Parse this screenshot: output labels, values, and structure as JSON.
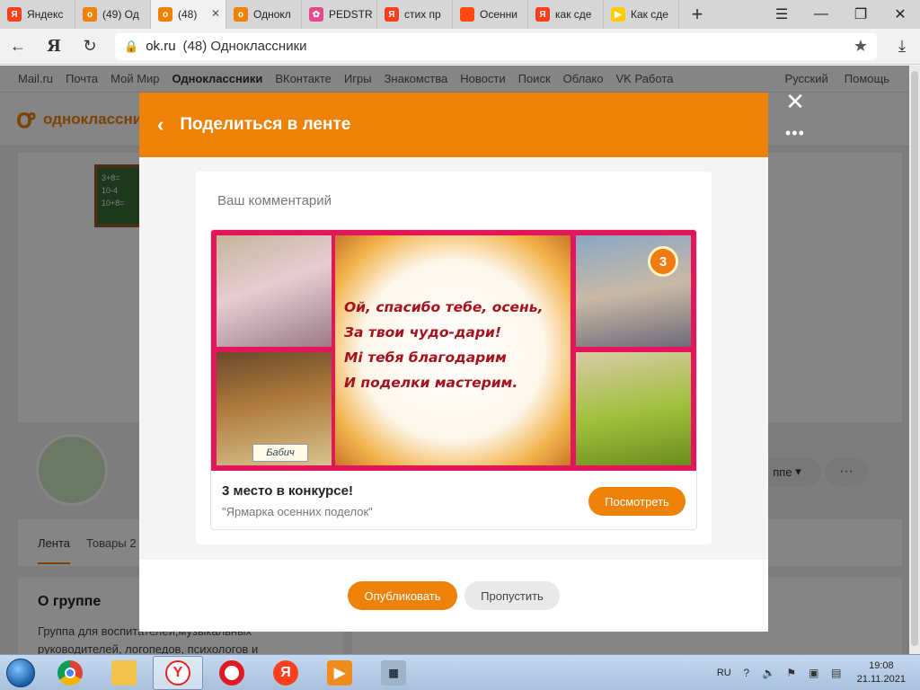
{
  "browser": {
    "tabs": [
      {
        "label": "Яндекс",
        "icon": "yandex-icon",
        "color": "#fc3f1d",
        "glyph": "Я"
      },
      {
        "label": "(49) Од",
        "icon": "odnoklassniki-icon",
        "color": "#ee8208",
        "glyph": "о"
      },
      {
        "label": "(48) ",
        "icon": "odnoklassniki-icon",
        "color": "#ee8208",
        "glyph": "о",
        "active": true
      },
      {
        "label": "Однокл",
        "icon": "odnoklassniki-icon",
        "color": "#ee8208",
        "glyph": "о"
      },
      {
        "label": "PEDSTR",
        "icon": "pedstrana-icon",
        "color": "#e64a8a",
        "glyph": "✿"
      },
      {
        "label": "стих пр",
        "icon": "yandex-icon",
        "color": "#fc3f1d",
        "glyph": "Я"
      },
      {
        "label": "Осенни",
        "icon": "square-orange-icon",
        "color": "#ff4b12",
        "glyph": ""
      },
      {
        "label": "как сде",
        "icon": "yandex-icon",
        "color": "#fc3f1d",
        "glyph": "Я"
      },
      {
        "label": "Как сде",
        "icon": "play-icon",
        "color": "#ffcc00",
        "glyph": "▶"
      }
    ],
    "address": {
      "domain": "ok.ru",
      "title": "(48) Одноклассники"
    }
  },
  "portal": {
    "links": [
      "Mail.ru",
      "Почта",
      "Мой Мир",
      "Одноклассники",
      "ВКонтакте",
      "Игры",
      "Знакомства",
      "Новости",
      "Поиск",
      "Облако",
      "VK Работа"
    ],
    "language": "Русский",
    "help": "Помощь"
  },
  "site": {
    "name": "одноклассники"
  },
  "group": {
    "tabs": [
      "Лента",
      "Товары 2"
    ],
    "about_title": "О группе",
    "about_text": "Группа для воспитателей,музыкальных руководителей, логопедов, психологов и",
    "join_label": "ппе"
  },
  "modal": {
    "title": "Поделиться в ленте",
    "comment_placeholder": "Ваш комментарий",
    "card": {
      "poem": [
        "Ой, спасибо тебе, осень,",
        "За твои чудо-дари!",
        "Мі тебя благодарим",
        "И поделки мастерим."
      ],
      "badge": "3",
      "nametag": "Бабич",
      "title": "3 место в конкурсе!",
      "subtitle": "\"Ярмарка осенних поделок\"",
      "view_label": "Посмотреть"
    },
    "publish_label": "Опубликовать",
    "skip_label": "Пропустить"
  },
  "taskbar": {
    "language": "RU",
    "time": "19:08",
    "date": "21.11.2021"
  },
  "colors": {
    "brand": "#ee8208",
    "collage_frame": "#e3165b"
  }
}
